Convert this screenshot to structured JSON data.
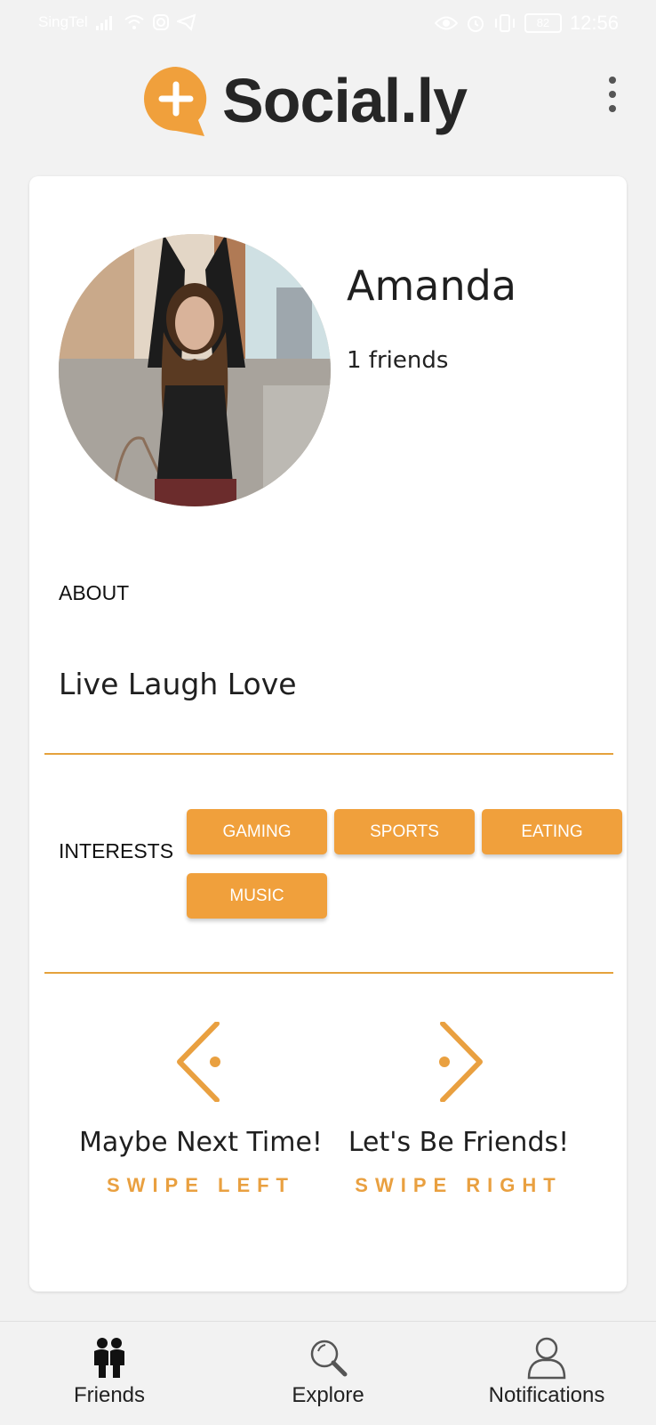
{
  "status_bar": {
    "carrier": "SingTel",
    "battery": "82",
    "time": "12:56"
  },
  "app": {
    "title": "Social.ly",
    "brand_color": "#f0a03c"
  },
  "profile": {
    "name": "Amanda",
    "friends_text": "1 friends"
  },
  "about": {
    "label": "ABOUT",
    "text": "Live Laugh Love"
  },
  "interests": {
    "label": "INTERESTS",
    "items": [
      "GAMING",
      "SPORTS",
      "EATING",
      "MUSIC"
    ]
  },
  "swipe": {
    "left": {
      "caption": "Maybe Next Time!",
      "hint": "SWIPE LEFT"
    },
    "right": {
      "caption": "Let's Be Friends!",
      "hint": "SWIPE RIGHT"
    }
  },
  "bottom_nav": {
    "items": [
      {
        "label": "Friends",
        "icon": "friends-icon",
        "active": true
      },
      {
        "label": "Explore",
        "icon": "explore-icon",
        "active": false
      },
      {
        "label": "Notifications",
        "icon": "user-icon",
        "active": false
      }
    ]
  }
}
